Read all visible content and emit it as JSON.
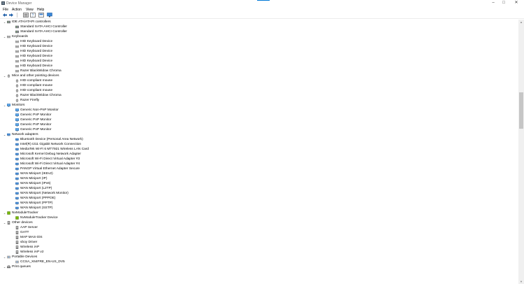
{
  "window": {
    "title": "Device Manager",
    "icon": "device-manager-icon"
  },
  "menu": {
    "file": "File",
    "action": "Action",
    "view": "View",
    "help": "Help"
  },
  "toolbar": [
    "back-icon",
    "forward-icon",
    "properties-grid-icon",
    "help-icon",
    "show-hidden-icon",
    "monitor-scan-icon"
  ],
  "tree": [
    {
      "kind": "cat",
      "label": "IDE ATA/ATAPI controllers",
      "icon": "ide-controller-icon"
    },
    {
      "kind": "dev",
      "label": "Standard SATA AHCI Controller",
      "icon": "ide-controller-icon"
    },
    {
      "kind": "dev",
      "label": "Standard SATA AHCI Controller",
      "icon": "ide-controller-icon"
    },
    {
      "kind": "cat",
      "label": "Keyboards",
      "icon": "keyboard-icon"
    },
    {
      "kind": "dev",
      "label": "HID Keyboard Device",
      "icon": "keyboard-icon"
    },
    {
      "kind": "dev",
      "label": "HID Keyboard Device",
      "icon": "keyboard-icon"
    },
    {
      "kind": "dev",
      "label": "HID Keyboard Device",
      "icon": "keyboard-icon"
    },
    {
      "kind": "dev",
      "label": "HID Keyboard Device",
      "icon": "keyboard-icon"
    },
    {
      "kind": "dev",
      "label": "HID Keyboard Device",
      "icon": "keyboard-icon"
    },
    {
      "kind": "dev",
      "label": "HID Keyboard Device",
      "icon": "keyboard-icon"
    },
    {
      "kind": "dev",
      "label": "Razer BlackWidow Chroma",
      "icon": "keyboard-icon"
    },
    {
      "kind": "cat",
      "label": "Mice and other pointing devices",
      "icon": "mouse-icon"
    },
    {
      "kind": "dev",
      "label": "HID-compliant mouse",
      "icon": "mouse-icon"
    },
    {
      "kind": "dev",
      "label": "HID-compliant mouse",
      "icon": "mouse-icon"
    },
    {
      "kind": "dev",
      "label": "HID-compliant mouse",
      "icon": "mouse-icon"
    },
    {
      "kind": "dev",
      "label": "Razer BlackWidow Chroma",
      "icon": "mouse-icon"
    },
    {
      "kind": "dev",
      "label": "Razer Firefly",
      "icon": "mouse-icon"
    },
    {
      "kind": "cat",
      "label": "Monitors",
      "icon": "monitor-icon"
    },
    {
      "kind": "dev",
      "label": "Generic Non-PnP Monitor",
      "icon": "monitor-icon"
    },
    {
      "kind": "dev",
      "label": "Generic PnP Monitor",
      "icon": "monitor-icon"
    },
    {
      "kind": "dev",
      "label": "Generic PnP Monitor",
      "icon": "monitor-icon"
    },
    {
      "kind": "dev",
      "label": "Generic PnP Monitor",
      "icon": "monitor-icon"
    },
    {
      "kind": "dev",
      "label": "Generic PnP Monitor",
      "icon": "monitor-icon"
    },
    {
      "kind": "cat",
      "label": "Network adapters",
      "icon": "network-adapter-icon"
    },
    {
      "kind": "dev",
      "label": "Bluetooth Device (Personal Area Network)",
      "icon": "network-adapter-icon"
    },
    {
      "kind": "dev",
      "label": "Intel(R) I211 Gigabit Network Connection",
      "icon": "network-adapter-icon"
    },
    {
      "kind": "dev",
      "label": "MediaTek Wi-Fi 6 MT7921 Wireless LAN Card",
      "icon": "network-adapter-icon"
    },
    {
      "kind": "dev",
      "label": "Microsoft Kernel Debug Network Adapter",
      "icon": "network-adapter-icon"
    },
    {
      "kind": "dev",
      "label": "Microsoft Wi-Fi Direct Virtual Adapter #3",
      "icon": "network-adapter-icon"
    },
    {
      "kind": "dev",
      "label": "Microsoft Wi-Fi Direct Virtual Adapter #4",
      "icon": "network-adapter-icon"
    },
    {
      "kind": "dev",
      "label": "PANGP Virtual Ethernet Adapter Secure",
      "icon": "network-adapter-icon"
    },
    {
      "kind": "dev",
      "label": "WAN Miniport (IKEv2)",
      "icon": "network-adapter-icon"
    },
    {
      "kind": "dev",
      "label": "WAN Miniport (IP)",
      "icon": "network-adapter-icon"
    },
    {
      "kind": "dev",
      "label": "WAN Miniport (IPv6)",
      "icon": "network-adapter-icon"
    },
    {
      "kind": "dev",
      "label": "WAN Miniport (L2TP)",
      "icon": "network-adapter-icon"
    },
    {
      "kind": "dev",
      "label": "WAN Miniport (Network Monitor)",
      "icon": "network-adapter-icon"
    },
    {
      "kind": "dev",
      "label": "WAN Miniport (PPPOE)",
      "icon": "network-adapter-icon"
    },
    {
      "kind": "dev",
      "label": "WAN Miniport (PPTP)",
      "icon": "network-adapter-icon"
    },
    {
      "kind": "dev",
      "label": "WAN Miniport (SSTP)",
      "icon": "network-adapter-icon"
    },
    {
      "kind": "cat",
      "label": "NvModuleTracker",
      "icon": "nvtracker-icon"
    },
    {
      "kind": "dev",
      "label": "NvModuleTracker Device",
      "icon": "nvtracker-icon"
    },
    {
      "kind": "cat",
      "label": "Other devices",
      "icon": "unknown-device-icon"
    },
    {
      "kind": "dev",
      "label": "AAP Server",
      "icon": "unknown-device-icon"
    },
    {
      "kind": "dev",
      "label": "GATT",
      "icon": "unknown-device-icon"
    },
    {
      "kind": "dev",
      "label": "MAP MAS-iOS",
      "icon": "unknown-device-icon"
    },
    {
      "kind": "dev",
      "label": "vboy Driver",
      "icon": "unknown-device-icon"
    },
    {
      "kind": "dev",
      "label": "Wireless iAP",
      "icon": "unknown-device-icon"
    },
    {
      "kind": "dev",
      "label": "Wireless iAP v2",
      "icon": "unknown-device-icon"
    },
    {
      "kind": "cat",
      "label": "Portable Devices",
      "icon": "portable-device-icon"
    },
    {
      "kind": "dev",
      "label": "CCSA_X64FRE_EN-US_DV5",
      "icon": "portable-device-icon"
    },
    {
      "kind": "cat",
      "label": "Print queues",
      "icon": "printer-icon"
    }
  ],
  "scrollbar": {
    "position": 0.33
  }
}
